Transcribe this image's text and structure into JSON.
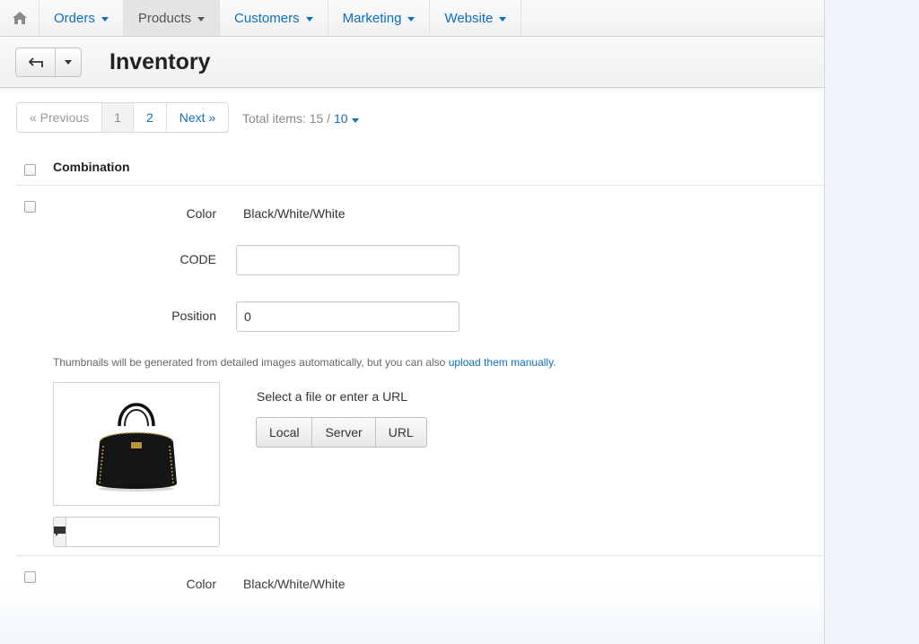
{
  "nav": {
    "home_icon": "home-icon",
    "items": [
      {
        "label": "Orders",
        "active": false
      },
      {
        "label": "Products",
        "active": true
      },
      {
        "label": "Customers",
        "active": false
      },
      {
        "label": "Marketing",
        "active": false
      },
      {
        "label": "Website",
        "active": false
      }
    ]
  },
  "header": {
    "back_icon": "back-arrow-icon",
    "dropdown_icon": "caret-down-icon",
    "title": "Inventory"
  },
  "pagination": {
    "previous": "« Previous",
    "pages": [
      "1",
      "2"
    ],
    "current_page": "1",
    "next": "Next »",
    "total_label": "Total items: 15 / ",
    "per_page": "10"
  },
  "table": {
    "header": "Combination",
    "rows": [
      {
        "color_label": "Color",
        "color_value": "Black/White/White",
        "code_label": "CODE",
        "code_value": "",
        "position_label": "Position",
        "position_value": "0",
        "thumb_note": "Thumbnails will be generated from detailed images automatically, but you can also ",
        "thumb_link": "upload them manually",
        "thumb_note_end": ".",
        "image_alt": "Black leather handbag",
        "alt_text_value": "",
        "select_file_text": "Select a file or enter a URL",
        "upload_buttons": [
          "Local",
          "Server",
          "URL"
        ]
      },
      {
        "color_label": "Color",
        "color_value": "Black/White/White"
      }
    ]
  },
  "colors": {
    "link": "#0d6fbd",
    "title": "#222222"
  }
}
